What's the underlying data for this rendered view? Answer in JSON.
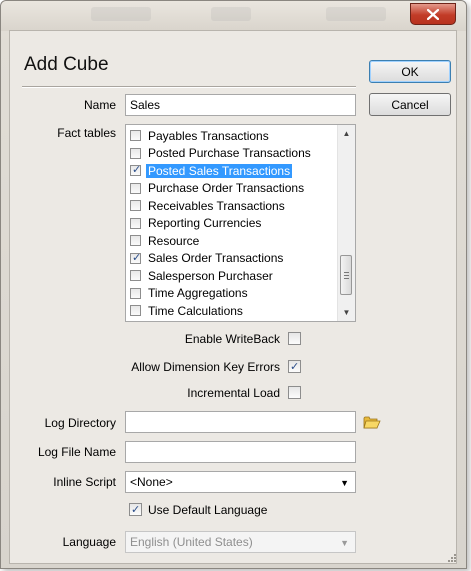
{
  "dialog": {
    "title": "Add Cube",
    "ok_label": "OK",
    "cancel_label": "Cancel"
  },
  "name": {
    "label": "Name",
    "value": "Sales"
  },
  "fact_tables": {
    "label": "Fact tables",
    "items": [
      {
        "label": "Payables Transactions",
        "checked": false,
        "selected": false
      },
      {
        "label": "Posted Purchase Transactions",
        "checked": false,
        "selected": false
      },
      {
        "label": "Posted Sales Transactions",
        "checked": true,
        "selected": true
      },
      {
        "label": "Purchase Order Transactions",
        "checked": false,
        "selected": false
      },
      {
        "label": "Receivables Transactions",
        "checked": false,
        "selected": false
      },
      {
        "label": "Reporting Currencies",
        "checked": false,
        "selected": false
      },
      {
        "label": "Resource",
        "checked": false,
        "selected": false
      },
      {
        "label": "Sales Order Transactions",
        "checked": true,
        "selected": false
      },
      {
        "label": "Salesperson Purchaser",
        "checked": false,
        "selected": false
      },
      {
        "label": "Time Aggregations",
        "checked": false,
        "selected": false
      },
      {
        "label": "Time Calculations",
        "checked": false,
        "selected": false
      }
    ]
  },
  "options": {
    "enable_writeback": {
      "label": "Enable WriteBack",
      "checked": false
    },
    "allow_dimension_key_errors": {
      "label": "Allow Dimension Key Errors",
      "checked": true
    },
    "incremental_load": {
      "label": "Incremental Load",
      "checked": false
    }
  },
  "log_directory": {
    "label": "Log Directory",
    "value": ""
  },
  "log_file_name": {
    "label": "Log File Name",
    "value": ""
  },
  "inline_script": {
    "label": "Inline Script",
    "value": "<None>"
  },
  "use_default_language": {
    "label": "Use Default Language",
    "checked": true
  },
  "language": {
    "label": "Language",
    "value": "English (United States)"
  },
  "icons": {
    "close": "close-icon",
    "folder": "folder-open-icon"
  },
  "colors": {
    "selection": "#3399ff",
    "close_button": "#c23c28"
  }
}
